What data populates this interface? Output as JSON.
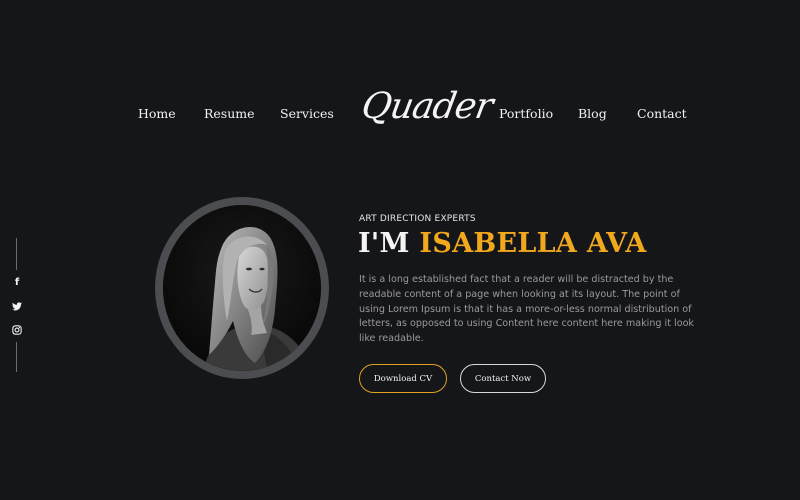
{
  "nav": {
    "home": "Home",
    "resume": "Resume",
    "services": "Services",
    "logo": "Quader",
    "portfolio": "Portfolio",
    "blog": "Blog",
    "contact": "Contact"
  },
  "social": {
    "icons": [
      "facebook-icon",
      "twitter-icon",
      "instagram-icon"
    ],
    "facebook_glyph": "f"
  },
  "hero": {
    "eyebrow": "ART DIRECTION EXPERTS",
    "headline_prefix": "I'M",
    "headline_name": "ISABELLA AVA",
    "description": "It is a long established fact that a reader will be distracted by the readable content of a page when looking at its layout. The point of using Lorem Ipsum is that it has a more-or-less normal distribution of letters, as opposed to using Content here content here making it look like readable.",
    "download_cv": "Download CV",
    "contact_now": "Contact Now"
  },
  "colors": {
    "background": "#15161a",
    "accent": "#f2a81d",
    "text": "#f2f2f2",
    "muted": "#9a9a9e"
  }
}
